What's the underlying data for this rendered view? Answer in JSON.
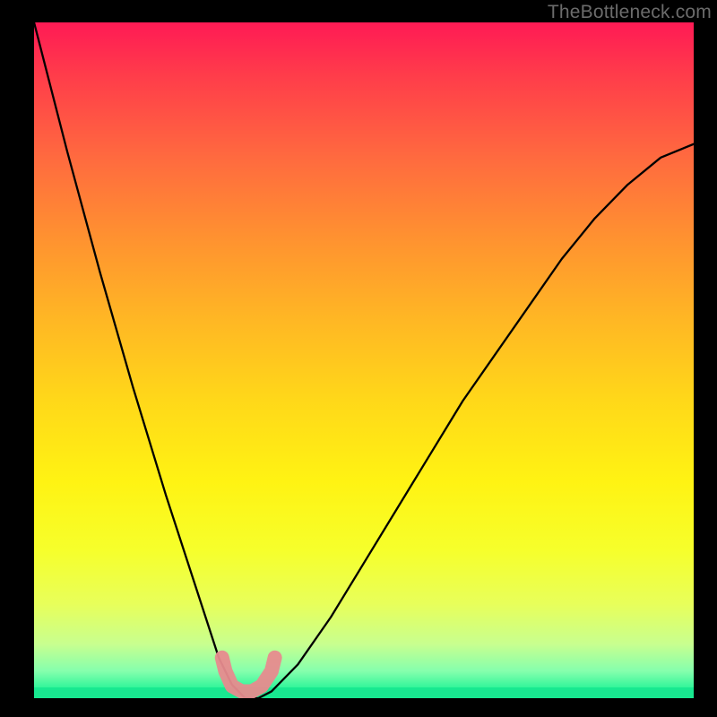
{
  "watermark": "TheBottleneck.com",
  "chart_data": {
    "type": "line",
    "title": "",
    "xlabel": "",
    "ylabel": "",
    "xlim": [
      0,
      1
    ],
    "ylim": [
      0,
      1
    ],
    "grid": false,
    "legend": false,
    "series": [
      {
        "name": "bottleneck-curve",
        "x": [
          0.0,
          0.05,
          0.1,
          0.15,
          0.2,
          0.25,
          0.28,
          0.3,
          0.32,
          0.34,
          0.36,
          0.4,
          0.45,
          0.5,
          0.55,
          0.6,
          0.65,
          0.7,
          0.75,
          0.8,
          0.85,
          0.9,
          0.95,
          1.0
        ],
        "y": [
          1.0,
          0.81,
          0.63,
          0.46,
          0.3,
          0.15,
          0.06,
          0.02,
          0.0,
          0.0,
          0.01,
          0.05,
          0.12,
          0.2,
          0.28,
          0.36,
          0.44,
          0.51,
          0.58,
          0.65,
          0.71,
          0.76,
          0.8,
          0.82
        ]
      },
      {
        "name": "highlight-band",
        "x": [
          0.285,
          0.29,
          0.3,
          0.315,
          0.33,
          0.345,
          0.36,
          0.365
        ],
        "y": [
          0.06,
          0.04,
          0.018,
          0.01,
          0.01,
          0.018,
          0.04,
          0.06
        ]
      }
    ],
    "background_gradient": {
      "direction": "vertical",
      "stops": [
        {
          "pos": 0.0,
          "color": "#ff1a55"
        },
        {
          "pos": 0.2,
          "color": "#ff6a3f"
        },
        {
          "pos": 0.44,
          "color": "#ffb724"
        },
        {
          "pos": 0.68,
          "color": "#fff313"
        },
        {
          "pos": 0.92,
          "color": "#c8ff8f"
        },
        {
          "pos": 1.0,
          "color": "#18e890"
        }
      ]
    }
  }
}
